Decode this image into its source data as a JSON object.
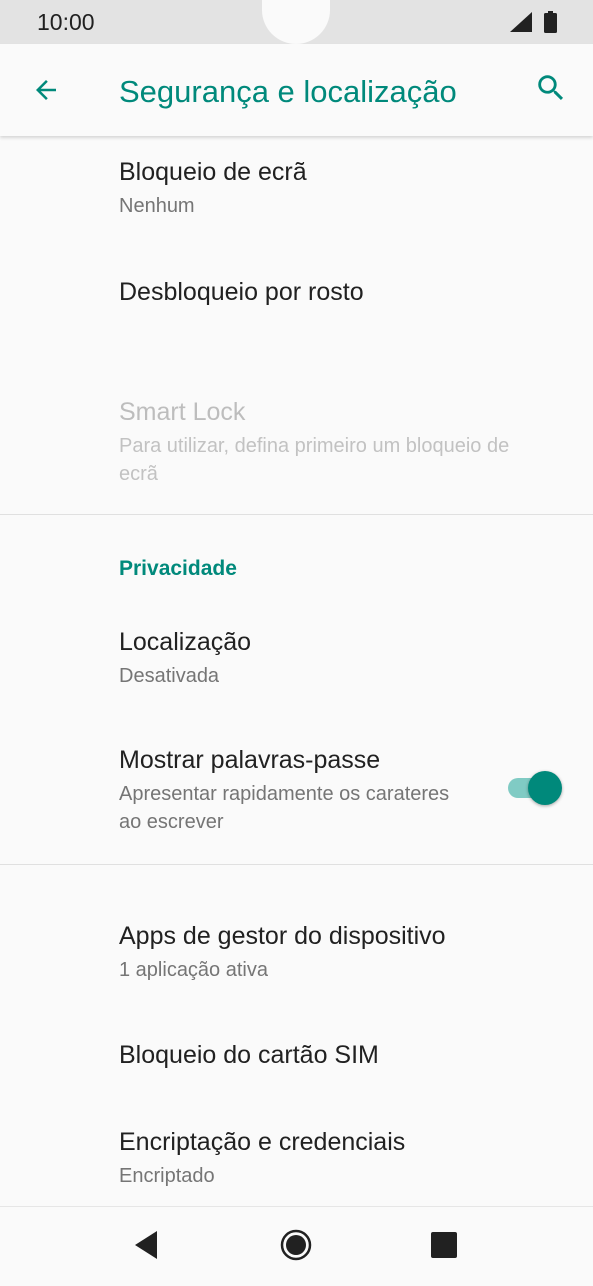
{
  "status_bar": {
    "time": "10:00",
    "icons": [
      "signal-icon",
      "battery-icon"
    ]
  },
  "app_bar": {
    "title": "Segurança e localização",
    "back_icon": "arrow-back-icon",
    "search_icon": "search-icon",
    "accent_color": "#00897b"
  },
  "items": {
    "screen_lock": {
      "title": "Bloqueio de ecrã",
      "summary": "Nenhum"
    },
    "face_unlock": {
      "title": "Desbloqueio por rosto"
    },
    "smart_lock": {
      "title": "Smart Lock",
      "summary": "Para utilizar, defina primeiro um bloqueio de ecrã"
    },
    "location": {
      "title": "Localização",
      "summary": "Desativada"
    },
    "show_passwords": {
      "title": "Mostrar palavras-passe",
      "summary": "Apresentar rapidamente os carateres ao escrever",
      "enabled": true
    },
    "device_admin": {
      "title": "Apps de gestor do dispositivo",
      "summary": "1 aplicação ativa"
    },
    "sim_lock": {
      "title": "Bloqueio do cartão SIM"
    },
    "encryption": {
      "title": "Encriptação e credenciais",
      "summary": "Encriptado"
    }
  },
  "sections": {
    "privacy": "Privacidade"
  },
  "nav_bar": {
    "back": "nav-back-icon",
    "home": "nav-home-icon",
    "recents": "nav-recents-icon"
  }
}
